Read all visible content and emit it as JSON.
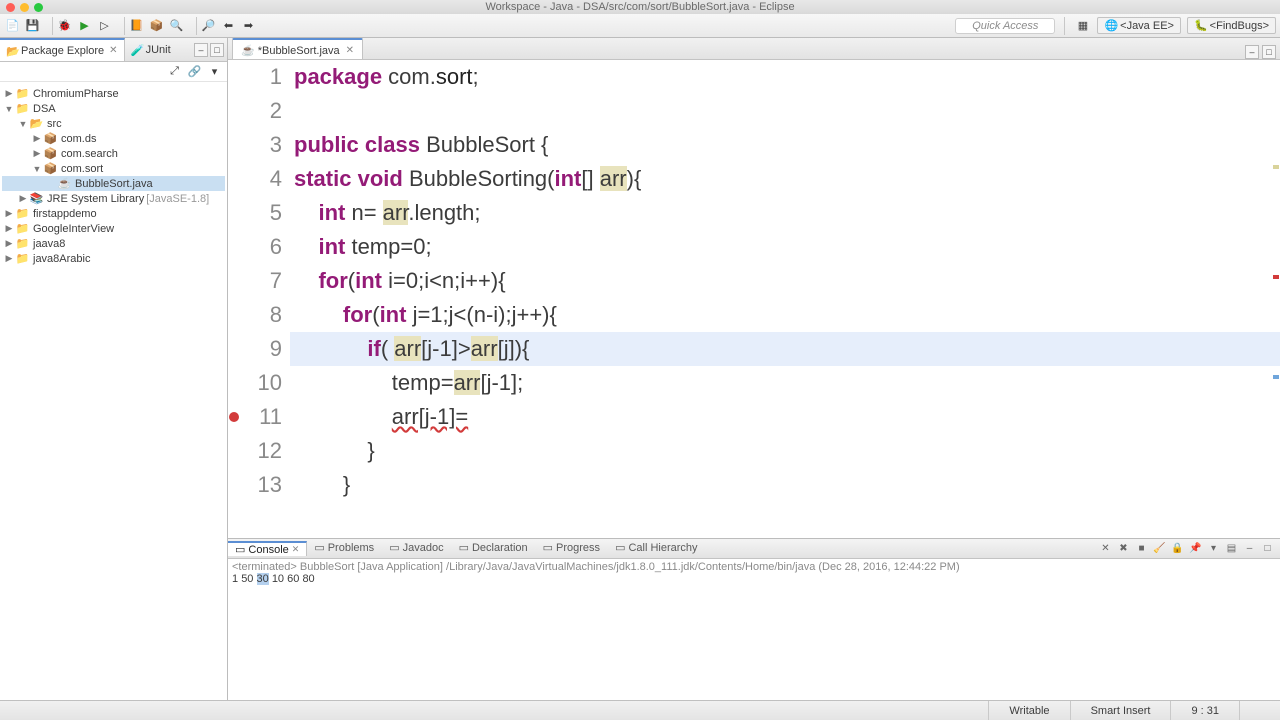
{
  "window": {
    "title": "Workspace - Java - DSA/src/com/sort/BubbleSort.java - Eclipse"
  },
  "quick_access": "Quick Access",
  "perspectives": [
    {
      "label": "<Java EE>"
    },
    {
      "label": "<FindBugs>"
    }
  ],
  "left": {
    "tabs": [
      {
        "label": "Package Explore",
        "active": true
      },
      {
        "label": "JUnit",
        "active": false
      }
    ],
    "tree": [
      {
        "depth": 0,
        "expand": "▶",
        "icon": "project",
        "label": "ChromiumPharse"
      },
      {
        "depth": 0,
        "expand": "▼",
        "icon": "project",
        "label": "DSA"
      },
      {
        "depth": 1,
        "expand": "▼",
        "icon": "srcfolder",
        "label": "src"
      },
      {
        "depth": 2,
        "expand": "▶",
        "icon": "package",
        "label": "com.ds"
      },
      {
        "depth": 2,
        "expand": "▶",
        "icon": "package",
        "label": "com.search"
      },
      {
        "depth": 2,
        "expand": "▼",
        "icon": "package",
        "label": "com.sort"
      },
      {
        "depth": 3,
        "expand": "",
        "icon": "javafile",
        "label": "BubbleSort.java",
        "selected": true
      },
      {
        "depth": 1,
        "expand": "▶",
        "icon": "library",
        "label": "JRE System Library",
        "decor": "[JavaSE-1.8]"
      },
      {
        "depth": 0,
        "expand": "▶",
        "icon": "project",
        "label": "firstappdemo"
      },
      {
        "depth": 0,
        "expand": "▶",
        "icon": "project",
        "label": "GoogleInterView"
      },
      {
        "depth": 0,
        "expand": "▶",
        "icon": "project",
        "label": "jaava8"
      },
      {
        "depth": 0,
        "expand": "▶",
        "icon": "project",
        "label": "java8Arabic"
      }
    ]
  },
  "editor": {
    "tab": {
      "label": "*BubbleSort.java",
      "dirty": true
    },
    "cursor": {
      "line": 9,
      "col": 31
    },
    "error_line": 11,
    "lines": [
      {
        "n": 1,
        "html": "<span class='kw'>package</span> com.<span class='plain'>sort</span>;"
      },
      {
        "n": 2,
        "html": ""
      },
      {
        "n": 3,
        "html": "<span class='kw'>public</span> <span class='kw'>class</span> BubbleSort {"
      },
      {
        "n": 4,
        "html": "<span class='kw'>static</span> <span class='kw'>void</span> BubbleSorting(<span class='kw'>int</span>[] <span class='param-h'>arr</span>){"
      },
      {
        "n": 5,
        "html": "    <span class='kw'>int</span> n= <span class='var-h'>arr</span>.length;"
      },
      {
        "n": 6,
        "html": "    <span class='kw'>int</span> temp=0;"
      },
      {
        "n": 7,
        "html": "    <span class='kw'>for</span>(<span class='kw'>int</span> i=0;i&lt;n;i++){"
      },
      {
        "n": 8,
        "html": "        <span class='kw'>for</span>(<span class='kw'>int</span> j=1;j&lt;(n-i);j++){"
      },
      {
        "n": 9,
        "html": "            <span class='kw'>if</span>( <span class='var-h'>arr</span>[j-1]&gt;<span class='var-h'>arr</span>[j]){",
        "hl": true
      },
      {
        "n": 10,
        "html": "                temp=<span class='var-h'>arr</span>[j-1];"
      },
      {
        "n": 11,
        "html": "                <u style='text-decoration:underline wavy #d23b3b;'>arr[j-1]=</u>"
      },
      {
        "n": 12,
        "html": "            }"
      },
      {
        "n": 13,
        "html": "        }"
      }
    ]
  },
  "bottom": {
    "tabs": [
      {
        "label": "Console",
        "active": true,
        "closable": true
      },
      {
        "label": "Problems"
      },
      {
        "label": "Javadoc"
      },
      {
        "label": "Declaration"
      },
      {
        "label": "Progress"
      },
      {
        "label": "Call Hierarchy"
      }
    ],
    "terminated": "<terminated> BubbleSort [Java Application] /Library/Java/JavaVirtualMachines/jdk1.8.0_111.jdk/Contents/Home/bin/java (Dec 28, 2016, 12:44:22 PM)",
    "output": {
      "tokens": [
        "1",
        "50",
        "30",
        "10",
        "60",
        "80"
      ],
      "selected_index": 2
    }
  },
  "status": {
    "writable": "Writable",
    "insert": "Smart Insert",
    "pos": "9 : 31"
  }
}
